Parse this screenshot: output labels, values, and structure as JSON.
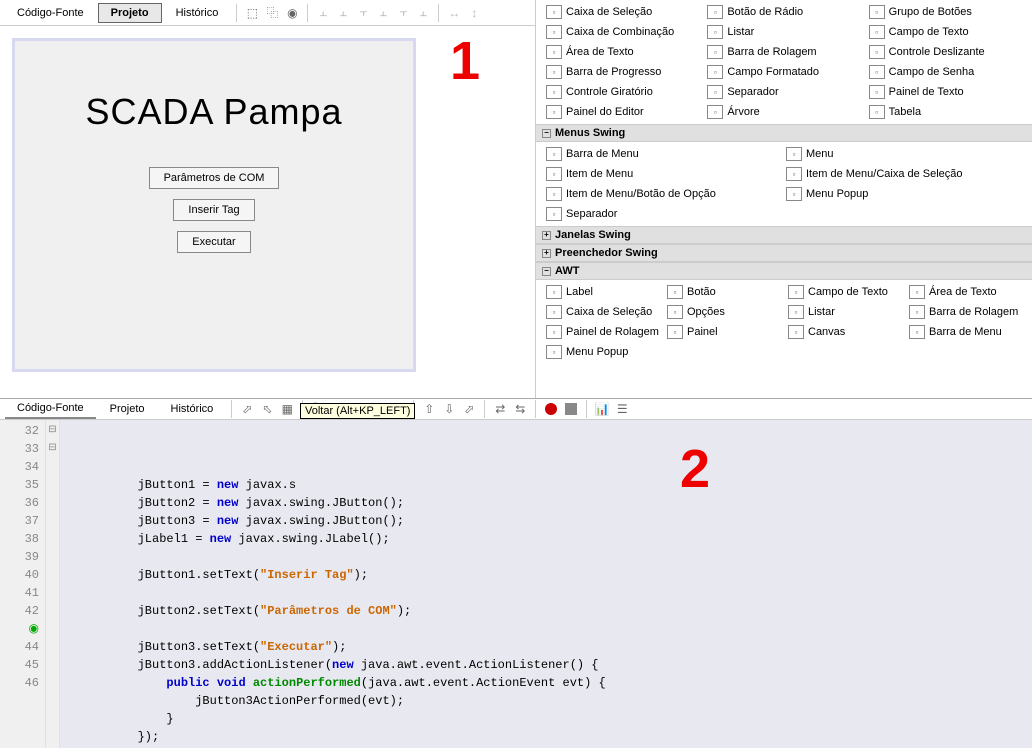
{
  "top_tabs": {
    "source": "Código-Fonte",
    "project": "Projeto",
    "history": "Histórico"
  },
  "designer": {
    "title": "SCADA Pampa",
    "btn1": "Parâmetros de COM",
    "btn2": "Inserir Tag",
    "btn3": "Executar"
  },
  "overlay1": "1",
  "overlay2": "2",
  "palette": {
    "swing_ctrls": [
      "Caixa de Seleção",
      "Botão de Rádio",
      "Grupo de Botões",
      "Caixa de Combinação",
      "Listar",
      "Campo de Texto",
      "Área de Texto",
      "Barra de Rolagem",
      "Controle Deslizante",
      "Barra de Progresso",
      "Campo Formatado",
      "Campo de Senha",
      "Controle Giratório",
      "Separador",
      "Painel de Texto",
      "Painel do Editor",
      "Árvore",
      "Tabela"
    ],
    "cat_menus": "Menus Swing",
    "menus": [
      "Barra de Menu",
      "Menu",
      "Item de Menu",
      "Item de Menu/Caixa de Seleção",
      "Item de Menu/Botão de Opção",
      "Menu Popup",
      "Separador"
    ],
    "cat_windows": "Janelas Swing",
    "cat_fillers": "Preenchedor Swing",
    "cat_awt": "AWT",
    "awt": [
      "Label",
      "Botão",
      "Campo de Texto",
      "Área de Texto",
      "Caixa de Seleção",
      "Opções",
      "Listar",
      "Barra de Rolagem",
      "Painel de Rolagem",
      "Painel",
      "Canvas",
      "Barra de Menu",
      "Menu Popup"
    ]
  },
  "bot_tabs": {
    "source": "Código-Fonte",
    "project": "Projeto",
    "history": "Histórico"
  },
  "tooltip": "Voltar (Alt+KP_LEFT)",
  "code": {
    "lines": [
      {
        "n": 32,
        "ind": 2,
        "tok": [
          {
            "t": "jButton1 = ",
            "c": ""
          },
          {
            "t": "new",
            "c": "kw"
          },
          {
            "t": " javax.s",
            "c": ""
          }
        ]
      },
      {
        "n": 33,
        "ind": 2,
        "tok": [
          {
            "t": "jButton2 = ",
            "c": ""
          },
          {
            "t": "new",
            "c": "kw"
          },
          {
            "t": " javax.swing.JButton();",
            "c": ""
          }
        ]
      },
      {
        "n": 34,
        "ind": 2,
        "tok": [
          {
            "t": "jButton3 = ",
            "c": ""
          },
          {
            "t": "new",
            "c": "kw"
          },
          {
            "t": " javax.swing.JButton();",
            "c": ""
          }
        ]
      },
      {
        "n": 35,
        "ind": 2,
        "tok": [
          {
            "t": "jLabel1 = ",
            "c": ""
          },
          {
            "t": "new",
            "c": "kw"
          },
          {
            "t": " javax.swing.JLabel();",
            "c": ""
          }
        ]
      },
      {
        "n": 36,
        "ind": 2,
        "tok": []
      },
      {
        "n": 37,
        "ind": 2,
        "tok": [
          {
            "t": "jButton1.setText(",
            "c": ""
          },
          {
            "t": "\"Inserir Tag\"",
            "c": "str"
          },
          {
            "t": ");",
            "c": ""
          }
        ]
      },
      {
        "n": 38,
        "ind": 2,
        "tok": []
      },
      {
        "n": 39,
        "ind": 2,
        "tok": [
          {
            "t": "jButton2.setText(",
            "c": ""
          },
          {
            "t": "\"Parâmetros de COM\"",
            "c": "str"
          },
          {
            "t": ");",
            "c": ""
          }
        ]
      },
      {
        "n": 40,
        "ind": 2,
        "tok": []
      },
      {
        "n": 41,
        "ind": 2,
        "tok": [
          {
            "t": "jButton3.setText(",
            "c": ""
          },
          {
            "t": "\"Executar\"",
            "c": "str"
          },
          {
            "t": ");",
            "c": ""
          }
        ]
      },
      {
        "n": 42,
        "ind": 2,
        "fold": "⊟",
        "tok": [
          {
            "t": "jButton3.addActionListener(",
            "c": ""
          },
          {
            "t": "new",
            "c": "kw"
          },
          {
            "t": " java.awt.event.ActionListener() {",
            "c": ""
          }
        ]
      },
      {
        "n": "◉",
        "ind": 3,
        "fold": "⊟",
        "tok": [
          {
            "t": "public",
            "c": "kw"
          },
          {
            "t": " ",
            "c": ""
          },
          {
            "t": "void",
            "c": "kw"
          },
          {
            "t": " ",
            "c": ""
          },
          {
            "t": "actionPerformed",
            "c": "ident"
          },
          {
            "t": "(java.awt.event.ActionEvent evt) {",
            "c": ""
          }
        ]
      },
      {
        "n": 44,
        "ind": 4,
        "tok": [
          {
            "t": "jButton3ActionPerformed(evt);",
            "c": ""
          }
        ]
      },
      {
        "n": 45,
        "ind": 3,
        "tok": [
          {
            "t": "}",
            "c": ""
          }
        ]
      },
      {
        "n": 46,
        "ind": 2,
        "tok": [
          {
            "t": "});",
            "c": ""
          }
        ]
      }
    ]
  }
}
